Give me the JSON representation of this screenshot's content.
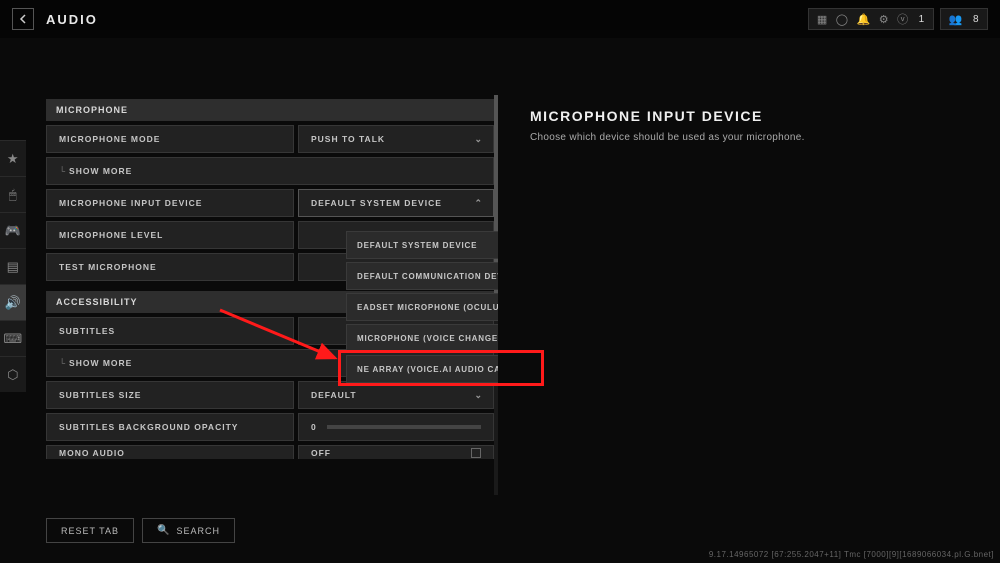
{
  "header": {
    "title": "AUDIO"
  },
  "topIcons": {
    "count1": "1",
    "count2": "8"
  },
  "leftRail": [
    "star",
    "mouse",
    "gamepad",
    "sliders",
    "volume",
    "keyboard",
    "hex"
  ],
  "sections": {
    "microphone": {
      "title": "MICROPHONE",
      "rows": {
        "mode": {
          "label": "MICROPHONE MODE",
          "value": "PUSH TO TALK"
        },
        "showMore1": {
          "label": "SHOW MORE"
        },
        "inputDevice": {
          "label": "MICROPHONE INPUT DEVICE",
          "value": "DEFAULT SYSTEM DEVICE"
        },
        "level": {
          "label": "MICROPHONE LEVEL"
        },
        "test": {
          "label": "TEST MICROPHONE"
        }
      }
    },
    "accessibility": {
      "title": "ACCESSIBILITY",
      "rows": {
        "subtitles": {
          "label": "SUBTITLES"
        },
        "showMore2": {
          "label": "SHOW MORE"
        },
        "subSize": {
          "label": "SUBTITLES SIZE",
          "value": "DEFAULT"
        },
        "subOpacity": {
          "label": "SUBTITLES BACKGROUND OPACITY",
          "value": "0"
        },
        "mono": {
          "label": "MONO AUDIO",
          "value": "OFF"
        }
      }
    }
  },
  "dropdown": {
    "items": [
      "DEFAULT SYSTEM DEVICE",
      "DEFAULT COMMUNICATION DEVICE",
      "EADSET MICROPHONE (OCULUS VIR",
      "MICROPHONE (VOICE CHANGER VIR",
      "NE ARRAY (VOICE.AI AUDIO CABLE)"
    ],
    "selectedIndex": 0
  },
  "info": {
    "title": "MICROPHONE INPUT DEVICE",
    "desc": "Choose which device should be used as your microphone."
  },
  "bottom": {
    "reset": "RESET TAB",
    "search": "SEARCH"
  },
  "footer": "9.17.14965072 [67:255.2047+11] Tmc [7000][9][1689066034.pl.G.bnet]"
}
